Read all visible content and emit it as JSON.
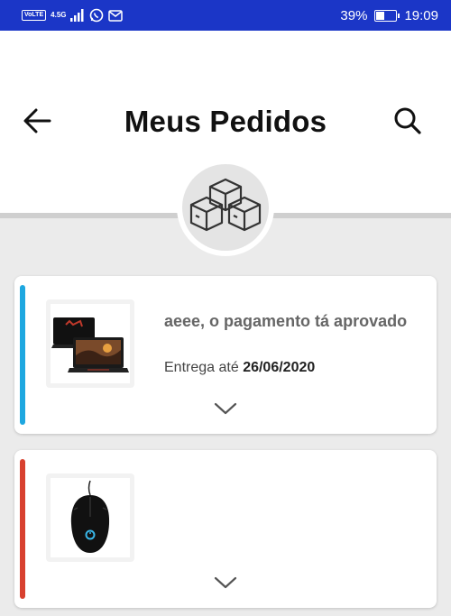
{
  "status_bar": {
    "volte": "VoLTE",
    "network": "4.5G",
    "battery_percent": "39%",
    "battery_level": 0.39,
    "time": "19:09"
  },
  "header": {
    "title": "Meus Pedidos",
    "back_icon": "arrow-left-icon",
    "search_icon": "search-icon"
  },
  "badge": {
    "icon": "boxes-icon"
  },
  "orders": [
    {
      "accent_color": "#1ea7e0",
      "product_icon": "laptop-image",
      "status_message": "aeee, o pagamento tá aprovado",
      "delivery_label": "Entrega até",
      "delivery_date": "26/06/2020"
    },
    {
      "accent_color": "#d8412f",
      "product_icon": "gaming-mouse-image"
    }
  ],
  "colors": {
    "status_bar": "#1b36c7",
    "background": "#ebebeb"
  }
}
